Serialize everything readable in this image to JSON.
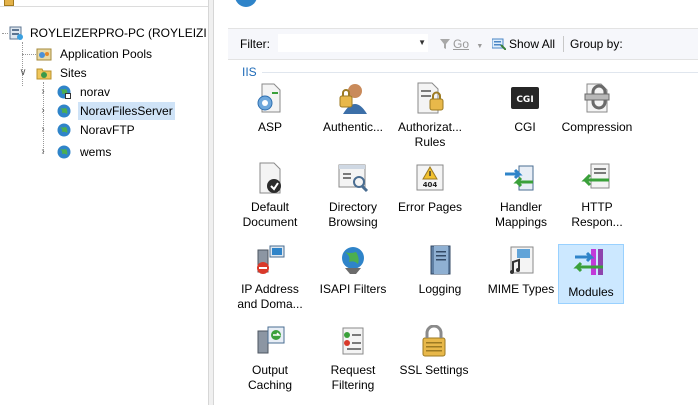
{
  "tree": {
    "server_label": "ROYLEIZERPRO-PC (ROYLEIZI",
    "app_pools_label": "Application Pools",
    "sites_label": "Sites",
    "site_items": [
      "norav",
      "NoravFilesServer",
      "NoravFTP",
      "wems"
    ],
    "selected_site": "NoravFilesServer"
  },
  "toolbar": {
    "filter_label": "Filter:",
    "filter_value": "",
    "go_label": "Go",
    "show_all_label": "Show All",
    "group_by_label": "Group by:"
  },
  "section": {
    "title": "IIS"
  },
  "features": {
    "asp": "ASP",
    "authentication": "Authentic...",
    "authorization_l1": "Authorizat...",
    "authorization_l2": "Rules",
    "cgi": "CGI",
    "cgi_badge": "CGI",
    "compression": "Compression",
    "default_document_l1": "Default",
    "default_document_l2": "Document",
    "directory_browsing_l1": "Directory",
    "directory_browsing_l2": "Browsing",
    "error_pages": "Error Pages",
    "error_badge": "404",
    "handler_mappings_l1": "Handler",
    "handler_mappings_l2": "Mappings",
    "http_response_l1": "HTTP",
    "http_response_l2": "Respon...",
    "ip_address_l1": "IP Address",
    "ip_address_l2": "and Doma...",
    "isapi_filters": "ISAPI Filters",
    "logging": "Logging",
    "mime_types": "MIME Types",
    "modules": "Modules",
    "output_caching_l1": "Output",
    "output_caching_l2": "Caching",
    "request_filtering_l1": "Request",
    "request_filtering_l2": "Filtering",
    "ssl_settings": "SSL Settings"
  },
  "selected_feature": "Modules",
  "icons": {
    "server": "server-icon",
    "app_pools": "application-pools-icon",
    "sites": "sites-folder-icon",
    "site": "globe-icon"
  },
  "colors": {
    "selection_tree": "#cfe3f7",
    "selection_tile": "#cce8ff",
    "section_blue": "#1e6bb8"
  }
}
